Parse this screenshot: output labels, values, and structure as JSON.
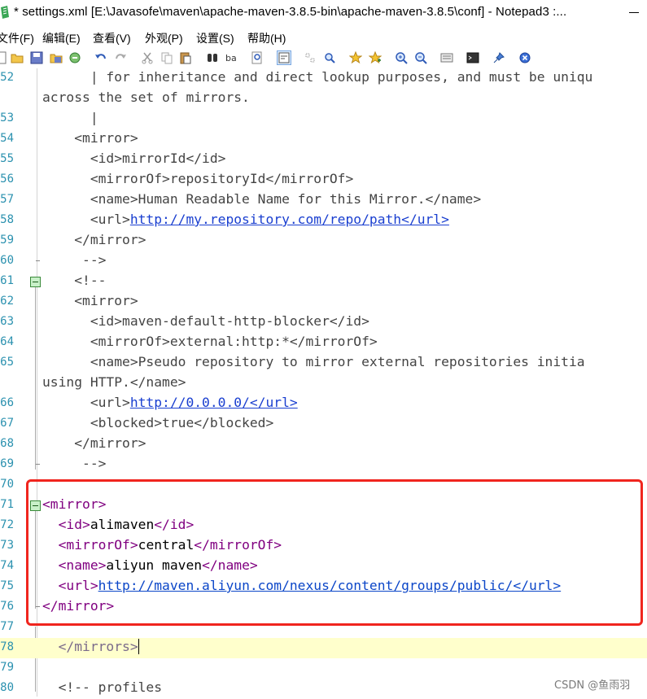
{
  "window": {
    "title": "* settings.xml [E:\\Javasofe\\maven\\apache-maven-3.8.5-bin\\apache-maven-3.8.5\\conf] - Notepad3 :..."
  },
  "menu": {
    "items": [
      "文件(F)",
      "编辑(E)",
      "查看(V)",
      "外观(P)",
      "设置(S)",
      "帮助(H)"
    ]
  },
  "toolbar": {
    "icons": [
      "new-file-icon",
      "open-folder-icon",
      "save-icon",
      "save-as-icon",
      "revert-icon",
      "undo-icon",
      "redo-icon",
      "cut-icon",
      "copy-icon",
      "paste-icon",
      "find-icon",
      "replace-icon",
      "find-in-files-icon",
      "word-wrap-icon",
      "select-icon",
      "zoom-search-icon",
      "bookmark-icon",
      "bookmark-all-icon",
      "zoom-in-icon",
      "zoom-out-icon",
      "scheme-icon",
      "console-icon",
      "pin-icon",
      "close-icon"
    ]
  },
  "editor": {
    "lines": [
      {
        "n": "52",
        "parts": [
          {
            "t": "      | for inheritance and direct lookup purposes, and must be uniqu",
            "c": "cmt"
          }
        ]
      },
      {
        "n": "",
        "parts": [
          {
            "t": "across the set of mirrors.",
            "c": "cmt"
          }
        ]
      },
      {
        "n": "53",
        "parts": [
          {
            "t": "      |",
            "c": "cmt"
          }
        ]
      },
      {
        "n": "54",
        "parts": [
          {
            "t": "    <mirror>",
            "c": "cmt"
          }
        ]
      },
      {
        "n": "55",
        "parts": [
          {
            "t": "      <id>mirrorId</id>",
            "c": "cmt"
          }
        ]
      },
      {
        "n": "56",
        "parts": [
          {
            "t": "      <mirrorOf>repositoryId</mirrorOf>",
            "c": "cmt"
          }
        ]
      },
      {
        "n": "57",
        "parts": [
          {
            "t": "      <name>Human Readable Name for this Mirror.</name>",
            "c": "cmt"
          }
        ]
      },
      {
        "n": "58",
        "parts": [
          {
            "t": "      <url>",
            "c": "cmt"
          },
          {
            "t": "http://my.repository.com/repo/path</url>",
            "c": "link"
          }
        ]
      },
      {
        "n": "59",
        "parts": [
          {
            "t": "    </mirror>",
            "c": "cmt"
          }
        ]
      },
      {
        "n": "60",
        "parts": [
          {
            "t": "     -->",
            "c": "cmt"
          }
        ]
      },
      {
        "n": "61",
        "parts": [
          {
            "t": "    <!--",
            "c": "cmt"
          }
        ]
      },
      {
        "n": "62",
        "parts": [
          {
            "t": "    <mirror>",
            "c": "cmt"
          }
        ]
      },
      {
        "n": "63",
        "parts": [
          {
            "t": "      <id>maven-default-http-blocker</id>",
            "c": "cmt"
          }
        ]
      },
      {
        "n": "64",
        "parts": [
          {
            "t": "      <mirrorOf>external:http:*</mirrorOf>",
            "c": "cmt"
          }
        ]
      },
      {
        "n": "65",
        "parts": [
          {
            "t": "      <name>Pseudo repository to mirror external repositories initia",
            "c": "cmt"
          }
        ]
      },
      {
        "n": "",
        "parts": [
          {
            "t": "using HTTP.</name>",
            "c": "cmt"
          }
        ]
      },
      {
        "n": "66",
        "parts": [
          {
            "t": "      <url>",
            "c": "cmt"
          },
          {
            "t": "http://0.0.0.0/</url>",
            "c": "link"
          }
        ]
      },
      {
        "n": "67",
        "parts": [
          {
            "t": "      <blocked>true</blocked>",
            "c": "cmt"
          }
        ]
      },
      {
        "n": "68",
        "parts": [
          {
            "t": "    </mirror>",
            "c": "cmt"
          }
        ]
      },
      {
        "n": "69",
        "parts": [
          {
            "t": "     -->",
            "c": "cmt"
          }
        ]
      },
      {
        "n": "70",
        "parts": []
      },
      {
        "n": "71",
        "parts": [
          {
            "t": "<mirror>",
            "c": "tag"
          }
        ]
      },
      {
        "n": "72",
        "parts": [
          {
            "t": "  <id>",
            "c": "tag"
          },
          {
            "t": "alimaven",
            "c": "txt"
          },
          {
            "t": "</id>",
            "c": "tag"
          }
        ]
      },
      {
        "n": "73",
        "parts": [
          {
            "t": "  <mirrorOf>",
            "c": "tag"
          },
          {
            "t": "central",
            "c": "txt"
          },
          {
            "t": "</mirrorOf>",
            "c": "tag"
          }
        ]
      },
      {
        "n": "74",
        "parts": [
          {
            "t": "  <name>",
            "c": "tag"
          },
          {
            "t": "aliyun maven",
            "c": "txt"
          },
          {
            "t": "</name>",
            "c": "tag"
          }
        ]
      },
      {
        "n": "75",
        "parts": [
          {
            "t": "  <url>",
            "c": "tag"
          },
          {
            "t": "http://maven.aliyun.com/nexus/content/groups/public/</url>",
            "c": "url"
          }
        ]
      },
      {
        "n": "76",
        "parts": [
          {
            "t": "</mirror>",
            "c": "tag"
          }
        ]
      },
      {
        "n": "77",
        "parts": []
      },
      {
        "n": "78",
        "parts": [
          {
            "t": "  </mirrors>",
            "c": "ptag"
          }
        ],
        "current": true
      },
      {
        "n": "79",
        "parts": []
      },
      {
        "n": "80",
        "parts": [
          {
            "t": "  <!-- profiles",
            "c": "cmt"
          }
        ]
      }
    ]
  },
  "watermark": "CSDN @鱼雨羽"
}
